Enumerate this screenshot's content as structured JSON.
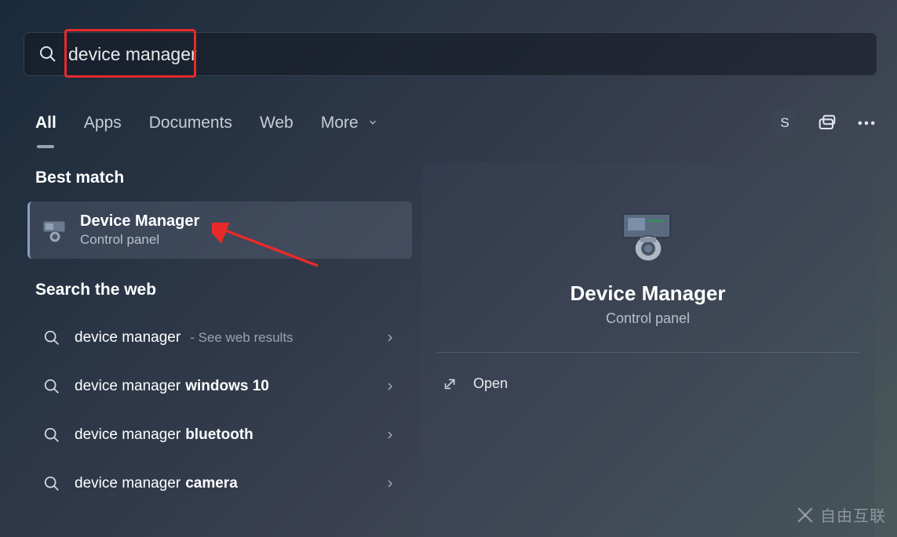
{
  "search": {
    "query": "device manager"
  },
  "tabs": {
    "all": "All",
    "apps": "Apps",
    "documents": "Documents",
    "web": "Web",
    "more": "More"
  },
  "user": {
    "initial": "S"
  },
  "sections": {
    "best_match": "Best match",
    "search_web": "Search the web"
  },
  "best_match": {
    "title": "Device Manager",
    "subtitle": "Control panel"
  },
  "web_results": [
    {
      "prefix": "device manager",
      "bold": "",
      "suffix": " - See web results"
    },
    {
      "prefix": "device manager ",
      "bold": "windows 10",
      "suffix": ""
    },
    {
      "prefix": "device manager ",
      "bold": "bluetooth",
      "suffix": ""
    },
    {
      "prefix": "device manager ",
      "bold": "camera",
      "suffix": ""
    }
  ],
  "preview": {
    "title": "Device Manager",
    "subtitle": "Control panel",
    "open_label": "Open"
  },
  "watermark": "自由互联"
}
